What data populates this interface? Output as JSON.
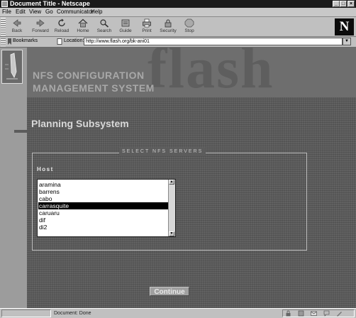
{
  "window": {
    "title": "Document Title - Netscape"
  },
  "menu": [
    "File",
    "Edit",
    "View",
    "Go",
    "Communicator",
    "Help"
  ],
  "toolbar": [
    {
      "label": "Back",
      "icon": "back-arrow-icon"
    },
    {
      "label": "Forward",
      "icon": "forward-arrow-icon"
    },
    {
      "label": "Reload",
      "icon": "reload-icon"
    },
    {
      "label": "Home",
      "icon": "home-icon"
    },
    {
      "label": "Search",
      "icon": "search-icon"
    },
    {
      "label": "Guide",
      "icon": "guide-icon"
    },
    {
      "label": "Print",
      "icon": "print-icon"
    },
    {
      "label": "Security",
      "icon": "security-icon"
    },
    {
      "label": "Stop",
      "icon": "stop-icon"
    }
  ],
  "brand_logo": "N",
  "location": {
    "bookmarks_label": "Bookmarks",
    "location_label": "Location:",
    "url": "http://www.flash.org/bk-ani01"
  },
  "page": {
    "background_word": "flash",
    "system_title_1": "NFS CONFIGURATION",
    "system_title_2": "MANAGEMENT SYSTEM",
    "subsystem_title": "Planning Subsystem",
    "legend": "SELECT NFS SERVERS",
    "host_label": "Host",
    "hosts": [
      "aramina",
      "barrens",
      "cabo",
      "carrasquite",
      "caruaru",
      "dif",
      "di2"
    ],
    "selected_host": "carrasquite",
    "continue_label": "Continue"
  },
  "status": {
    "text": "Document: Done"
  },
  "colors": {
    "page_bg": "#5c5c5c",
    "sidebar": "#9c9c9c",
    "selection": "#000000"
  }
}
